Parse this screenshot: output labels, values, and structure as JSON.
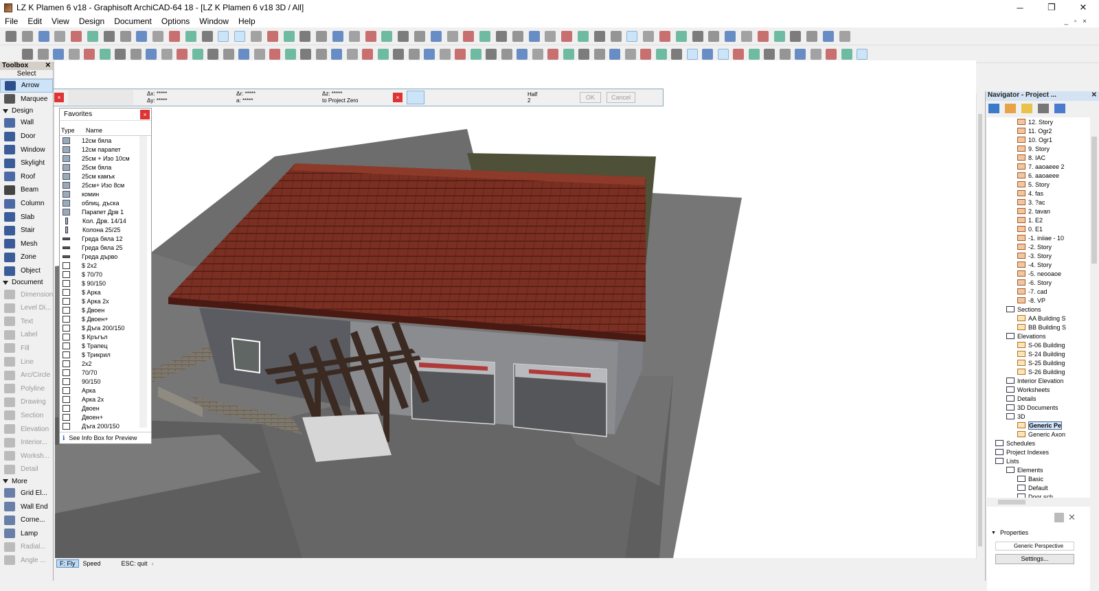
{
  "window": {
    "title": "LZ K Plamen 6 v18 - Graphisoft ArchiCAD-64 18 - [LZ K Plamen 6 v18 3D / All]",
    "minimize": "─",
    "restore": "❐",
    "close": "✕"
  },
  "menu": [
    "File",
    "Edit",
    "View",
    "Design",
    "Document",
    "Options",
    "Window",
    "Help"
  ],
  "toolbox": {
    "title": "Toolbox",
    "select_label": "Select",
    "select_items": [
      {
        "label": "Arrow",
        "icon": "arrow-icon"
      },
      {
        "label": "Marquee",
        "icon": "marquee-icon"
      }
    ],
    "design_label": "Design",
    "design_items": [
      {
        "label": "Wall",
        "icon": "wall-icon"
      },
      {
        "label": "Door",
        "icon": "door-icon"
      },
      {
        "label": "Window",
        "icon": "window-icon"
      },
      {
        "label": "Skylight",
        "icon": "skylight-icon"
      },
      {
        "label": "Roof",
        "icon": "roof-icon"
      },
      {
        "label": "Beam",
        "icon": "beam-icon"
      },
      {
        "label": "Column",
        "icon": "column-icon"
      },
      {
        "label": "Slab",
        "icon": "slab-icon"
      },
      {
        "label": "Stair",
        "icon": "stair-icon"
      },
      {
        "label": "Mesh",
        "icon": "mesh-icon"
      },
      {
        "label": "Zone",
        "icon": "zone-icon"
      },
      {
        "label": "Object",
        "icon": "object-icon"
      }
    ],
    "document_label": "Document",
    "document_items": [
      {
        "label": "Dimension",
        "icon": "dimension-icon"
      },
      {
        "label": "Level Di...",
        "icon": "level-dimension-icon"
      },
      {
        "label": "Text",
        "icon": "text-icon"
      },
      {
        "label": "Label",
        "icon": "label-icon"
      },
      {
        "label": "Fill",
        "icon": "fill-icon"
      },
      {
        "label": "Line",
        "icon": "line-icon"
      },
      {
        "label": "Arc/Circle",
        "icon": "arc-circle-icon"
      },
      {
        "label": "Polyline",
        "icon": "polyline-icon"
      },
      {
        "label": "Drawing",
        "icon": "drawing-icon"
      },
      {
        "label": "Section",
        "icon": "section-icon"
      },
      {
        "label": "Elevation",
        "icon": "elevation-icon"
      },
      {
        "label": "Interior...",
        "icon": "interior-elevation-icon"
      },
      {
        "label": "Worksh...",
        "icon": "worksheet-icon"
      },
      {
        "label": "Detail",
        "icon": "detail-icon"
      }
    ],
    "more_label": "More",
    "more_items": [
      {
        "label": "Grid El...",
        "icon": "grid-element-icon"
      },
      {
        "label": "Wall End",
        "icon": "wall-end-icon"
      },
      {
        "label": "Corne...",
        "icon": "corner-window-icon"
      },
      {
        "label": "Lamp",
        "icon": "lamp-icon"
      },
      {
        "label": "Radial...",
        "icon": "radial-dimension-icon"
      },
      {
        "label": "Angle ...",
        "icon": "angle-dimension-icon"
      }
    ]
  },
  "infobox": {
    "dx": "Δx: *****",
    "dy": "Δy: *****",
    "dr": "Δr: *****",
    "a": "a: *****",
    "dz": "Δz: *****",
    "zero": "to Project Zero",
    "half": "Half",
    "half_n": "2",
    "ok": "OK",
    "cancel": "Cancel"
  },
  "favorites": {
    "title": "Favorites",
    "col_type": "Type",
    "col_name": "Name",
    "items": [
      {
        "name": "12см бяла",
        "kind": "wall"
      },
      {
        "name": "12см парапет",
        "kind": "wall"
      },
      {
        "name": "25см + Изо 10см",
        "kind": "wall"
      },
      {
        "name": "25см бяла",
        "kind": "wall"
      },
      {
        "name": "25см камък",
        "kind": "wall"
      },
      {
        "name": "25см+ Изо 8см",
        "kind": "wall"
      },
      {
        "name": "комин",
        "kind": "wall"
      },
      {
        "name": "облиц. дъска",
        "kind": "wall"
      },
      {
        "name": "Парапет Дрв 1",
        "kind": "wall"
      },
      {
        "name": "Кол. Дрв. 14/14",
        "kind": "col"
      },
      {
        "name": "Колона 25/25",
        "kind": "col"
      },
      {
        "name": "Греда бяла 12",
        "kind": "beam"
      },
      {
        "name": "Греда бяла 25",
        "kind": "beam"
      },
      {
        "name": "Греда дърво",
        "kind": "beam"
      },
      {
        "name": "$ 2x2",
        "kind": "win"
      },
      {
        "name": "$ 70/70",
        "kind": "win"
      },
      {
        "name": "$ 90/150",
        "kind": "win"
      },
      {
        "name": "$ Арка",
        "kind": "win"
      },
      {
        "name": "$ Арка 2x",
        "kind": "win"
      },
      {
        "name": "$ Двоен",
        "kind": "win"
      },
      {
        "name": "$ Двоен+",
        "kind": "win"
      },
      {
        "name": "$ Дъга 200/150",
        "kind": "win"
      },
      {
        "name": "$ Кръгъл",
        "kind": "win"
      },
      {
        "name": "$ Трапец",
        "kind": "win"
      },
      {
        "name": "$ Трикрил",
        "kind": "win"
      },
      {
        "name": "2x2",
        "kind": "win"
      },
      {
        "name": "70/70",
        "kind": "win"
      },
      {
        "name": "90/150",
        "kind": "win"
      },
      {
        "name": "Арка",
        "kind": "win"
      },
      {
        "name": "Арка 2x",
        "kind": "win"
      },
      {
        "name": "Двоен",
        "kind": "win"
      },
      {
        "name": "Двоен+",
        "kind": "win"
      },
      {
        "name": "Дъга 200/150",
        "kind": "win"
      }
    ],
    "footer": "See Info Box for Preview"
  },
  "navigator": {
    "title": "Navigator - Project ...",
    "rows": [
      {
        "label": "12. Story",
        "indent": 3,
        "kind": "story"
      },
      {
        "label": "11. Ogr2",
        "indent": 3,
        "kind": "story"
      },
      {
        "label": "10. Ogr1",
        "indent": 3,
        "kind": "story"
      },
      {
        "label": "9. Story",
        "indent": 3,
        "kind": "story"
      },
      {
        "label": "8. IAC",
        "indent": 3,
        "kind": "story"
      },
      {
        "label": "7. aaoaeee 2",
        "indent": 3,
        "kind": "story"
      },
      {
        "label": "6. aaoaeee",
        "indent": 3,
        "kind": "story"
      },
      {
        "label": "5. Story",
        "indent": 3,
        "kind": "story"
      },
      {
        "label": "4. fas",
        "indent": 3,
        "kind": "story"
      },
      {
        "label": "3. ?ac",
        "indent": 3,
        "kind": "story"
      },
      {
        "label": "2. tavan",
        "indent": 3,
        "kind": "story"
      },
      {
        "label": "1. E2",
        "indent": 3,
        "kind": "story"
      },
      {
        "label": "0. E1",
        "indent": 3,
        "kind": "story"
      },
      {
        "label": "-1. iniiae - 10",
        "indent": 3,
        "kind": "story"
      },
      {
        "label": "-2. Story",
        "indent": 3,
        "kind": "story"
      },
      {
        "label": "-3. Story",
        "indent": 3,
        "kind": "story"
      },
      {
        "label": "-4. Story",
        "indent": 3,
        "kind": "story"
      },
      {
        "label": "-5. neooaoe",
        "indent": 3,
        "kind": "story"
      },
      {
        "label": "-6. Story",
        "indent": 3,
        "kind": "story"
      },
      {
        "label": "-7. cad",
        "indent": 3,
        "kind": "story"
      },
      {
        "label": "-8. VP",
        "indent": 3,
        "kind": "story"
      },
      {
        "label": "Sections",
        "indent": 2,
        "kind": "sec"
      },
      {
        "label": "AA Building S",
        "indent": 3,
        "kind": "bldg"
      },
      {
        "label": "BB Building S",
        "indent": 3,
        "kind": "bldg"
      },
      {
        "label": "Elevations",
        "indent": 2,
        "kind": "sec"
      },
      {
        "label": "S-06 Building",
        "indent": 3,
        "kind": "bldg"
      },
      {
        "label": "S-24 Building",
        "indent": 3,
        "kind": "bldg"
      },
      {
        "label": "S-25 Building",
        "indent": 3,
        "kind": "bldg"
      },
      {
        "label": "S-26 Building",
        "indent": 3,
        "kind": "bldg"
      },
      {
        "label": "Interior Elevation",
        "indent": 2,
        "kind": "sec"
      },
      {
        "label": "Worksheets",
        "indent": 2,
        "kind": "sec"
      },
      {
        "label": "Details",
        "indent": 2,
        "kind": "sec"
      },
      {
        "label": "3D Documents",
        "indent": 2,
        "kind": "sec"
      },
      {
        "label": "3D",
        "indent": 2,
        "kind": "sec"
      },
      {
        "label": "Generic Pe",
        "indent": 3,
        "kind": "bldg",
        "hl": true
      },
      {
        "label": "Generic Axon",
        "indent": 3,
        "kind": "bldg"
      },
      {
        "label": "Schedules",
        "indent": 1,
        "kind": "sec"
      },
      {
        "label": "Project Indexes",
        "indent": 1,
        "kind": "sec"
      },
      {
        "label": "Lists",
        "indent": 1,
        "kind": "sec"
      },
      {
        "label": "Elements",
        "indent": 2,
        "kind": "sec"
      },
      {
        "label": "Basic",
        "indent": 3,
        "kind": "sec"
      },
      {
        "label": "Default",
        "indent": 3,
        "kind": "sec"
      },
      {
        "label": "Door sch",
        "indent": 3,
        "kind": "sec"
      }
    ],
    "properties_label": "Properties",
    "properties_value": "Generic Perspective",
    "settings_label": "Settings..."
  },
  "statusbar": {
    "fly": "F: Fly",
    "speed": "Speed",
    "esc": "ESC: quit"
  },
  "colors": {
    "roof": "#7a2f22",
    "wall": "#8a8c90",
    "ground": "#6b6b6b",
    "pergola": "#3a2a22"
  }
}
